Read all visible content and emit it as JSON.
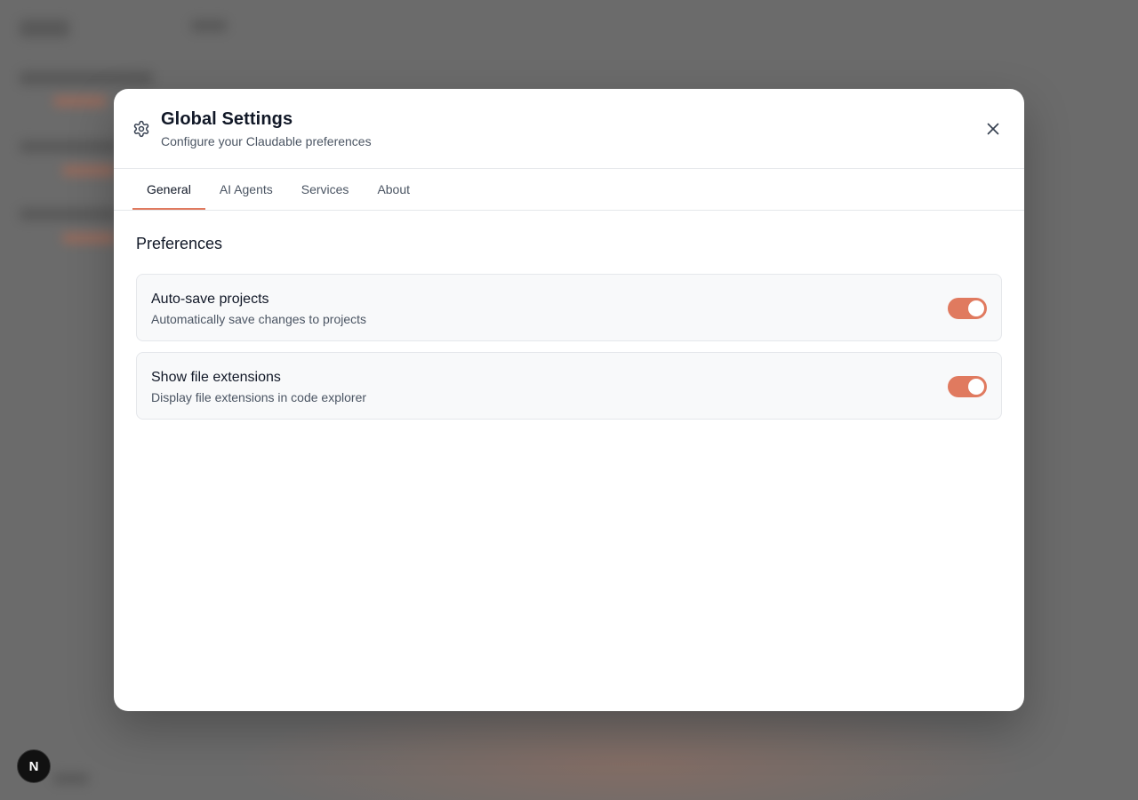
{
  "modal": {
    "title": "Global Settings",
    "subtitle": "Configure your Claudable preferences",
    "header_icon": "gear-icon",
    "close_icon": "close-icon"
  },
  "tabs": [
    {
      "label": "General",
      "active": true
    },
    {
      "label": "AI Agents",
      "active": false
    },
    {
      "label": "Services",
      "active": false
    },
    {
      "label": "About",
      "active": false
    }
  ],
  "general": {
    "section_title": "Preferences",
    "preferences": [
      {
        "title": "Auto-save projects",
        "description": "Automatically save changes to projects",
        "enabled": true
      },
      {
        "title": "Show file extensions",
        "description": "Display file extensions in code explorer",
        "enabled": true
      }
    ]
  },
  "dev_badge": {
    "label": "N"
  },
  "colors": {
    "accent": "#e07a5f",
    "overlay": "#6b6b6b",
    "card_bg": "#f8f9fa"
  }
}
